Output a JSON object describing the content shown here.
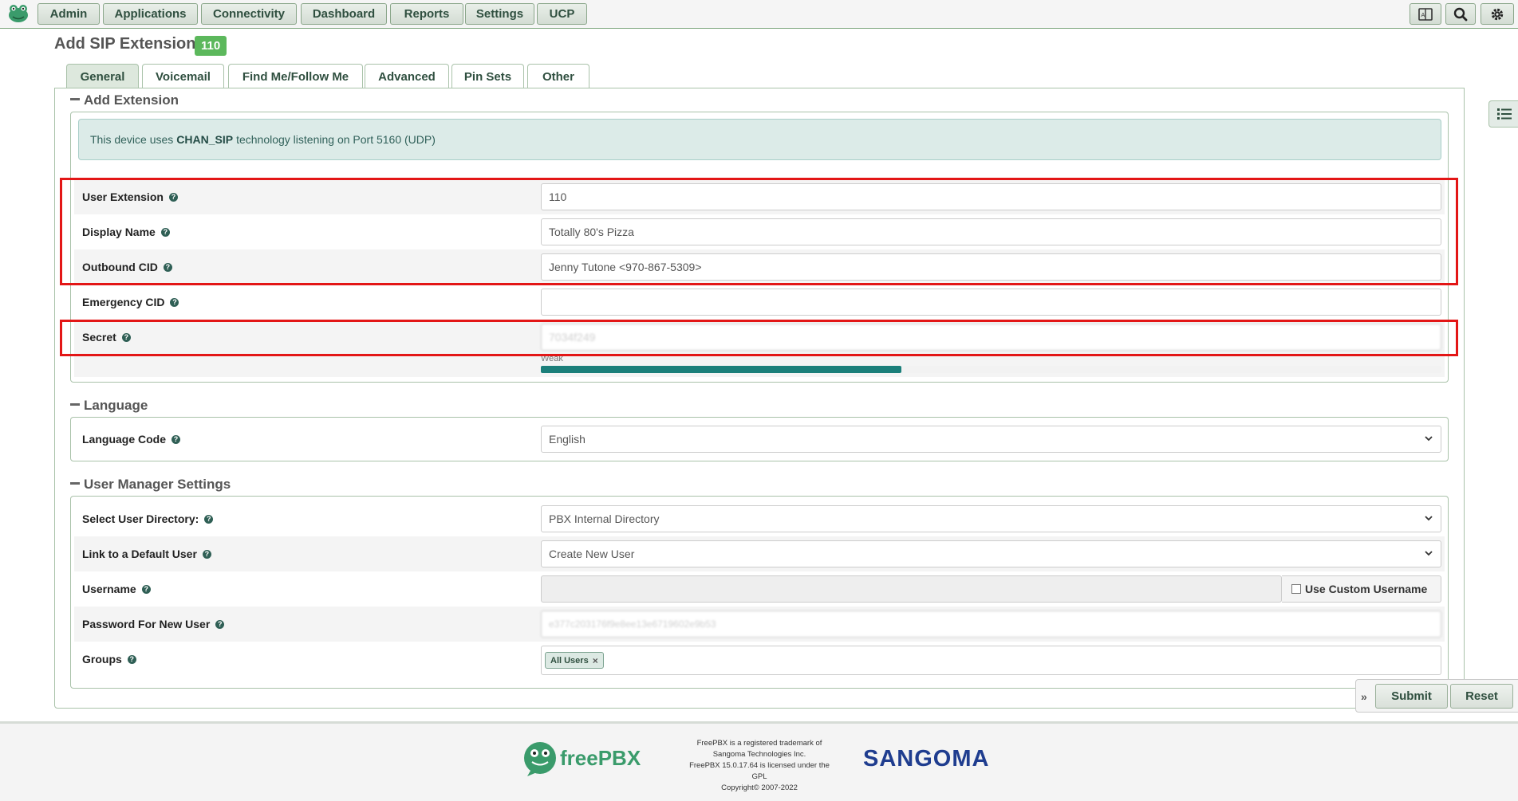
{
  "nav": {
    "items": [
      "Admin",
      "Applications",
      "Connectivity",
      "Dashboard",
      "Reports",
      "Settings",
      "UCP"
    ]
  },
  "page": {
    "title": "Add SIP Extension",
    "badge": "110"
  },
  "tabs": [
    "General",
    "Voicemail",
    "Find Me/Follow Me",
    "Advanced",
    "Pin Sets",
    "Other"
  ],
  "sections": {
    "add_extension": "Add Extension",
    "language": "Language",
    "user_manager": "User Manager Settings"
  },
  "info": {
    "prefix": "This device uses",
    "tech": "CHAN_SIP",
    "suffix": "technology listening on Port 5160 (UDP)"
  },
  "fields": {
    "user_extension": {
      "label": "User Extension",
      "value": "110"
    },
    "display_name": {
      "label": "Display Name",
      "value": "Totally 80's Pizza"
    },
    "outbound_cid": {
      "label": "Outbound CID",
      "value": "Jenny Tutone <970-867-5309>"
    },
    "emergency_cid": {
      "label": "Emergency CID",
      "value": ""
    },
    "secret": {
      "label": "Secret",
      "value": "7034f249",
      "strength_label": "Weak",
      "strength": 0.4
    },
    "language_code": {
      "label": "Language Code",
      "value": "English"
    },
    "user_directory": {
      "label": "Select User Directory:",
      "value": "PBX Internal Directory"
    },
    "default_user": {
      "label": "Link to a Default User",
      "value": "Create New User"
    },
    "username": {
      "label": "Username",
      "value": "",
      "custom_label": "Use Custom Username"
    },
    "password_new_user": {
      "label": "Password For New User",
      "value": "e377c203176f9e8ee13e6719602e9b53"
    },
    "groups": {
      "label": "Groups",
      "tags": [
        "All Users"
      ]
    }
  },
  "actions": {
    "submit": "Submit",
    "reset": "Reset"
  },
  "footer": {
    "logo_text": "freePBX",
    "copyright_lines": [
      "FreePBX is a registered trademark of",
      "Sangoma Technologies Inc.",
      "FreePBX 15.0.17.64 is licensed under the",
      "GPL",
      "Copyright© 2007-2022"
    ],
    "sangoma": "SANGOMA"
  },
  "colors": {
    "accent_green": "#5cb85c",
    "highlight_red": "#e31616",
    "strength_teal": "#1b7f7a",
    "sangoma_blue": "#1f3d8f"
  }
}
